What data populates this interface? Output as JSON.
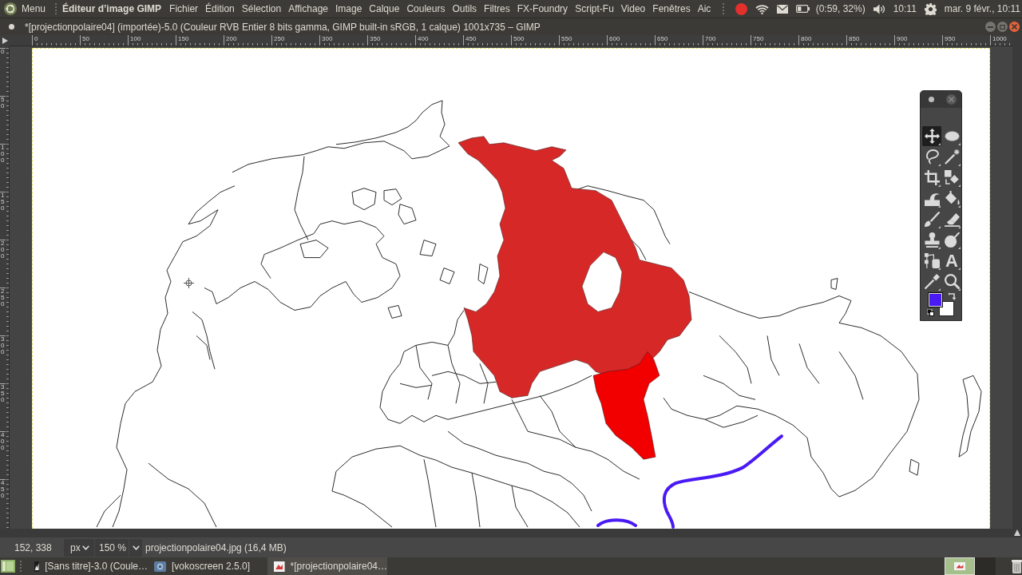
{
  "top_panel": {
    "menu_label": "Menu",
    "app_title": "Éditeur d’image GIMP",
    "menus": [
      "Fichier",
      "Édition",
      "Sélection",
      "Affichage",
      "Image",
      "Calque",
      "Couleurs",
      "Outils",
      "Filtres",
      "FX-Foundry",
      "Script-Fu",
      "Video",
      "Fenêtres",
      "Aic"
    ],
    "indicators": [
      {
        "kind": "record"
      },
      {
        "kind": "wifi"
      },
      {
        "kind": "mail"
      },
      {
        "kind": "battery",
        "text": "(0:59, 32%)"
      },
      {
        "kind": "volume"
      },
      {
        "kind": "time",
        "text": "10:11"
      },
      {
        "kind": "settings"
      },
      {
        "kind": "date",
        "text": "mar. 9 févr., 10:11"
      }
    ]
  },
  "window": {
    "title": "*[projectionpolaire04] (importée)-5.0 (Couleur RVB Entier 8 bits gamma, GIMP built-in sRGB, 1 calque) 1001x735 – GIMP"
  },
  "rulers": {
    "horizontal": [
      "0",
      "50",
      "100",
      "150",
      "200",
      "250",
      "300",
      "350",
      "400",
      "450",
      "500",
      "550",
      "600",
      "650",
      "700",
      "750",
      "800",
      "850",
      "900",
      "950",
      "1000"
    ],
    "vertical": [
      "0",
      "50",
      "100",
      "150",
      "200",
      "250",
      "300",
      "350",
      "400",
      "450"
    ]
  },
  "toolbox": {
    "tools": [
      {
        "kind": "move",
        "selected": true
      },
      {
        "kind": "ellipse_select",
        "selected": false
      },
      {
        "kind": "lasso",
        "selected": false
      },
      {
        "kind": "fuzzy_select",
        "selected": false
      },
      {
        "kind": "crop",
        "selected": false
      },
      {
        "kind": "transform",
        "selected": false
      },
      {
        "kind": "warp",
        "selected": false
      },
      {
        "kind": "bucket_fill",
        "selected": false
      },
      {
        "kind": "paintbrush",
        "selected": false
      },
      {
        "kind": "eraser",
        "selected": false
      },
      {
        "kind": "clone",
        "selected": false
      },
      {
        "kind": "dodge",
        "selected": false
      },
      {
        "kind": "paths",
        "selected": false
      },
      {
        "kind": "text",
        "selected": false,
        "glyph": "A"
      },
      {
        "kind": "color_picker",
        "selected": false
      },
      {
        "kind": "zoom",
        "selected": false
      }
    ],
    "colors": [
      {
        "kind": "foreground",
        "color": "#4a1af5"
      },
      {
        "kind": "background",
        "color": "#ffffff"
      }
    ]
  },
  "status_bar": {
    "pointer_position": "152, 338",
    "unit": "px",
    "zoom": "150 %",
    "image_info": "projectionpolaire04.jpg (16,4 MB)"
  },
  "taskbar": {
    "items": [
      {
        "kind": "editor",
        "label": "[Sans titre]-3.0 (Coule…",
        "selected": false
      },
      {
        "kind": "recorder",
        "label": "[vokoscreen 2.5.0]",
        "selected": false
      },
      {
        "kind": "image",
        "label": "*[projectionpolaire04…",
        "selected": true
      }
    ],
    "workspaces": [
      {
        "selected": true
      },
      {
        "selected": false
      }
    ]
  }
}
